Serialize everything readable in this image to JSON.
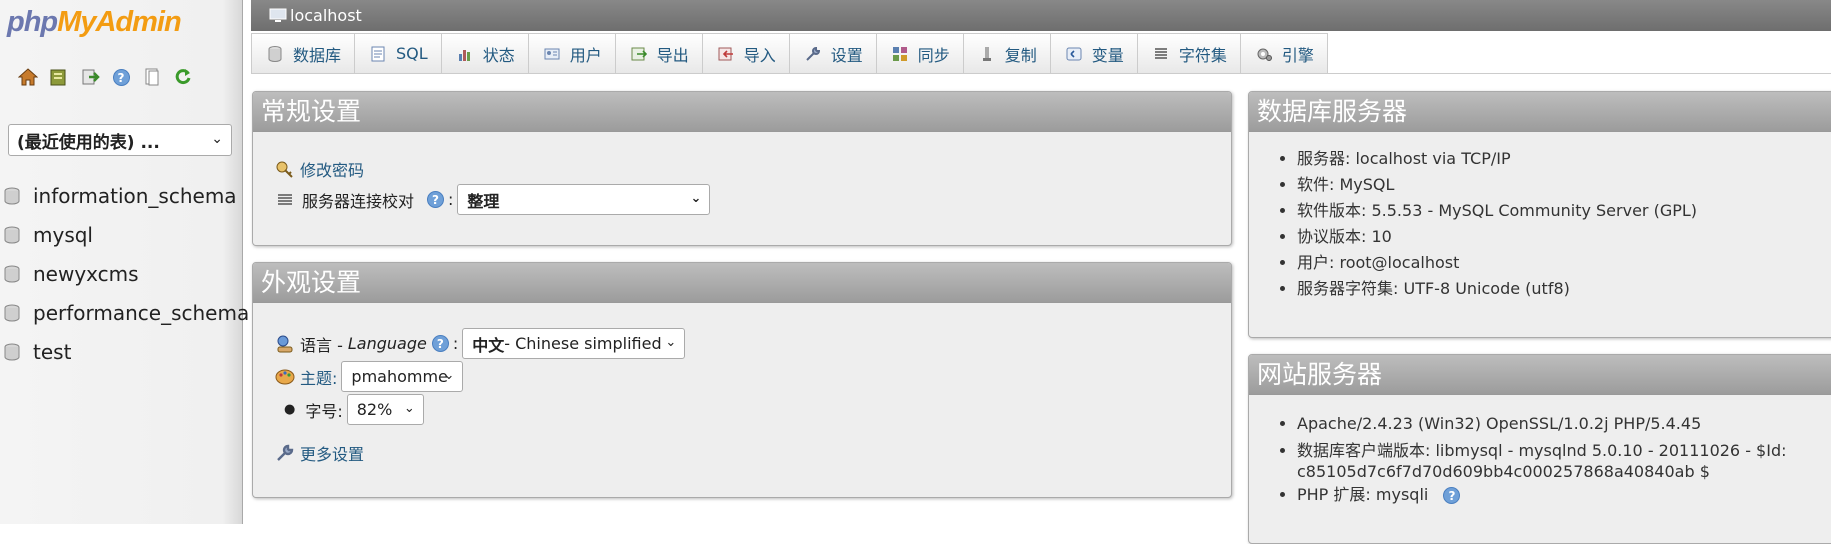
{
  "nav": {
    "logo_php": "php",
    "logo_myadmin": "MyAdmin",
    "icons": [
      "home-icon",
      "database-icon",
      "logout-icon",
      "help-icon",
      "docs-icon",
      "reload-icon"
    ],
    "recent_tables": "(最近使用的表) ...",
    "databases": [
      "information_schema",
      "mysql",
      "newyxcms",
      "performance_schema",
      "test"
    ]
  },
  "topbar": {
    "server": "localhost"
  },
  "tabs": [
    {
      "label": "数据库",
      "icon": "database-icon"
    },
    {
      "label": "SQL",
      "icon": "sql-icon"
    },
    {
      "label": "状态",
      "icon": "status-icon"
    },
    {
      "label": "用户",
      "icon": "users-icon"
    },
    {
      "label": "导出",
      "icon": "export-icon"
    },
    {
      "label": "导入",
      "icon": "import-icon"
    },
    {
      "label": "设置",
      "icon": "wrench-icon"
    },
    {
      "label": "同步",
      "icon": "sync-icon"
    },
    {
      "label": "复制",
      "icon": "replication-icon"
    },
    {
      "label": "变量",
      "icon": "variables-icon"
    },
    {
      "label": "字符集",
      "icon": "charset-icon"
    },
    {
      "label": "引擎",
      "icon": "engine-icon"
    }
  ],
  "general": {
    "title": "常规设置",
    "change_password": "修改密码",
    "collation_label": "服务器连接校对",
    "collation_value": "整理"
  },
  "appearance": {
    "title": "外观设置",
    "language_label": "语言 - ",
    "language_en": "Language",
    "language_value_bold": "中文",
    "language_value_rest": " - Chinese simplified",
    "theme_label": "主题:",
    "theme_value": "pmahomme",
    "fontsize_label": "字号:",
    "fontsize_value": "82%",
    "more_settings": "更多设置"
  },
  "db_server": {
    "title": "数据库服务器",
    "items": [
      "服务器: localhost via TCP/IP",
      "软件: MySQL",
      "软件版本: 5.5.53 - MySQL Community Server (GPL)",
      "协议版本: 10",
      "用户: root@localhost",
      "服务器字符集: UTF-8 Unicode (utf8)"
    ]
  },
  "web_server": {
    "title": "网站服务器",
    "item1": "Apache/2.4.23 (Win32) OpenSSL/1.0.2j PHP/5.4.45",
    "item2": "数据库客户端版本: libmysql - mysqlnd 5.0.10 - 20111026 - $Id: c85105d7c6f7d70d609bb4c000257868a40840ab $",
    "item3": "PHP 扩展: mysqli"
  },
  "colors": {
    "link": "#235a81",
    "header_gray": "#9c9c9c",
    "logo_blue": "#6c78af",
    "logo_orange": "#f39c12"
  }
}
